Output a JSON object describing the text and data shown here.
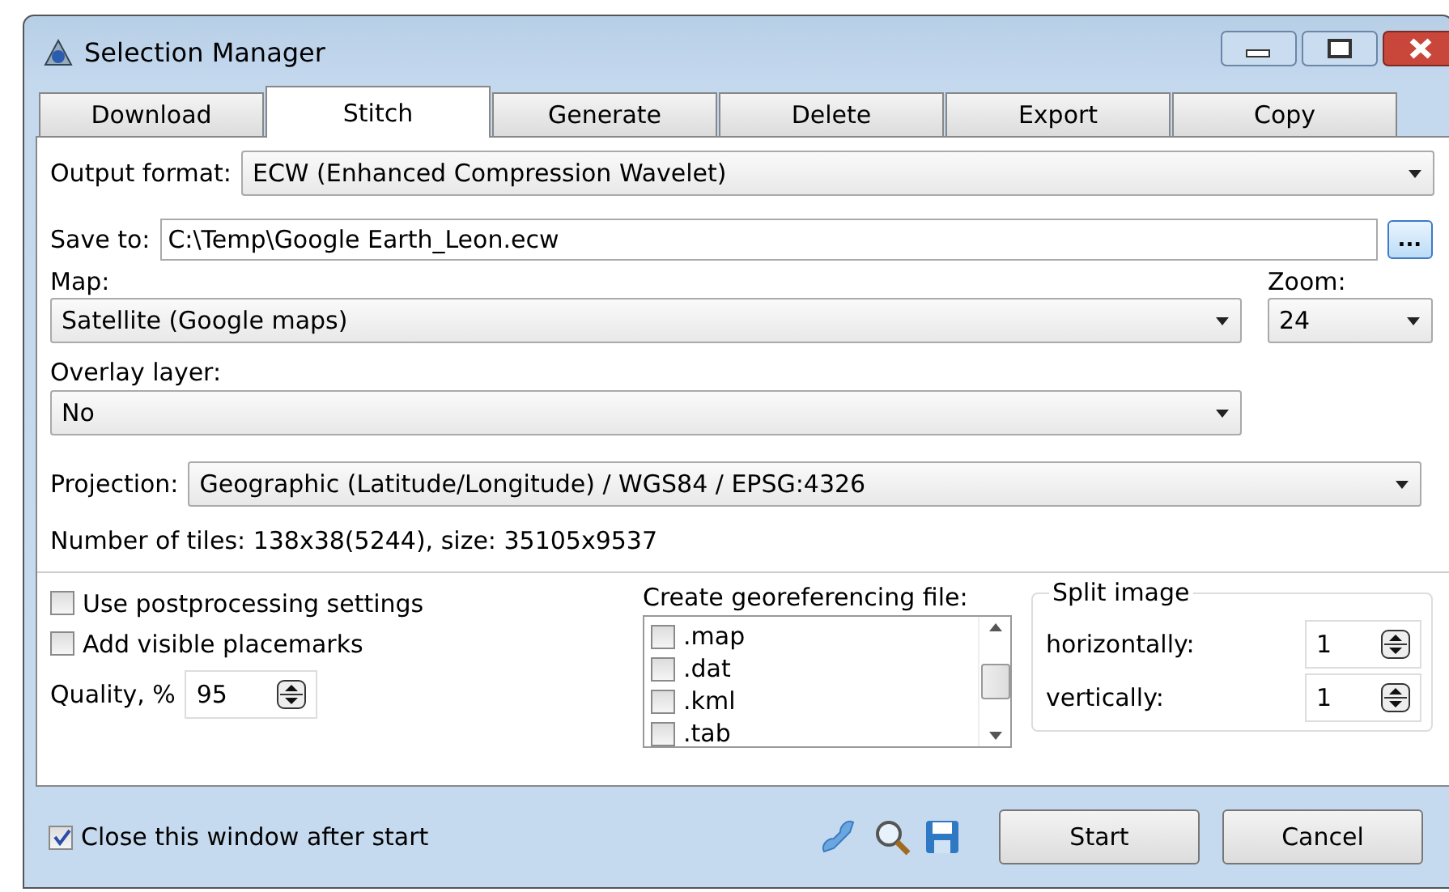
{
  "window": {
    "title": "Selection Manager"
  },
  "tabs": [
    {
      "label": "Download",
      "selected": false
    },
    {
      "label": "Stitch",
      "selected": true
    },
    {
      "label": "Generate",
      "selected": false
    },
    {
      "label": "Delete",
      "selected": false
    },
    {
      "label": "Export",
      "selected": false
    },
    {
      "label": "Copy",
      "selected": false
    }
  ],
  "output_format": {
    "label": "Output format:",
    "value": "ECW (Enhanced Compression Wavelet)"
  },
  "save_to": {
    "label": "Save to:",
    "value": "C:\\Temp\\Google Earth_Leon.ecw",
    "browse": "..."
  },
  "map": {
    "label": "Map:",
    "value": "Satellite (Google maps)"
  },
  "zoom": {
    "label": "Zoom:",
    "value": "24"
  },
  "overlay": {
    "label": "Overlay layer:",
    "value": "No"
  },
  "projection": {
    "label": "Projection:",
    "value": "Geographic (Latitude/Longitude) / WGS84 / EPSG:4326"
  },
  "tiles_info": "Number of tiles: 138x38(5244), size: 35105x9537",
  "options": [
    {
      "label": "Use postprocessing settings",
      "checked": false
    },
    {
      "label": "Add visible placemarks",
      "checked": false
    }
  ],
  "quality": {
    "label": "Quality, %",
    "value": "95"
  },
  "georef": {
    "label": "Create georeferencing file:",
    "items": [
      {
        "label": ".map",
        "checked": false
      },
      {
        "label": ".dat",
        "checked": false
      },
      {
        "label": ".kml",
        "checked": false
      },
      {
        "label": ".tab",
        "checked": false
      }
    ]
  },
  "split": {
    "title": "Split image",
    "horizontally": {
      "label": "horizontally:",
      "value": "1"
    },
    "vertically": {
      "label": "vertically:",
      "value": "1"
    }
  },
  "close_after_start": {
    "label": "Close this window after start",
    "checked": true
  },
  "buttons": [
    "Start",
    "Cancel"
  ]
}
